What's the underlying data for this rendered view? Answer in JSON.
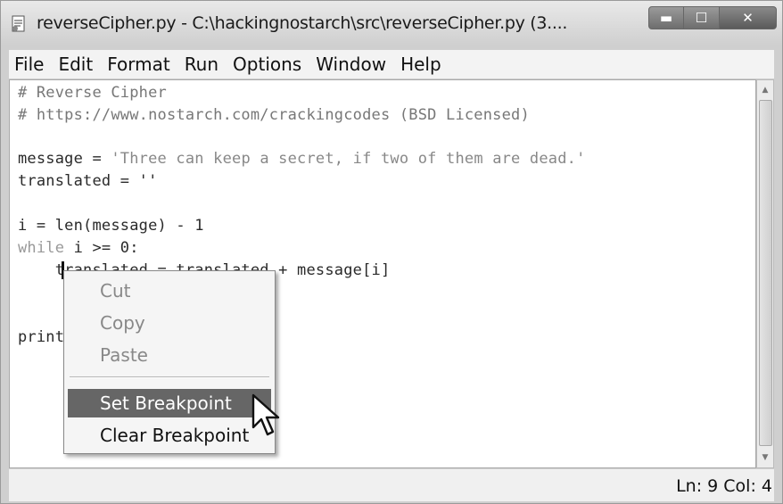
{
  "window": {
    "title": "reverseCipher.py - C:\\hackingnostarch\\src\\reverseCipher.py (3....",
    "minimize_glyph": "▬",
    "maximize_glyph": "☐",
    "close_glyph": "✕"
  },
  "menu": [
    "File",
    "Edit",
    "Format",
    "Run",
    "Options",
    "Window",
    "Help"
  ],
  "code": {
    "line1": "# Reverse Cipher",
    "line2": "# https://www.nostarch.com/crackingcodes (BSD Licensed)",
    "line4_pre": "message = ",
    "line4_str": "'Three can keep a secret, if two of them are dead.'",
    "line5": "translated = ''",
    "line7": "i = len(message) - 1",
    "line8_kw": "while",
    "line8_rest": " i >= 0:",
    "line9": "    translated = translated + message[i]",
    "line12": "print"
  },
  "context_menu": {
    "cut": "Cut",
    "copy": "Copy",
    "paste": "Paste",
    "set_breakpoint": "Set Breakpoint",
    "clear_breakpoint": "Clear Breakpoint"
  },
  "status": {
    "position": "Ln: 9  Col: 4"
  },
  "icons": {
    "app": "python-file-icon",
    "scroll_up": "scroll-up-arrow-icon",
    "scroll_down": "scroll-down-arrow-icon",
    "pointer": "mouse-pointer-icon"
  }
}
